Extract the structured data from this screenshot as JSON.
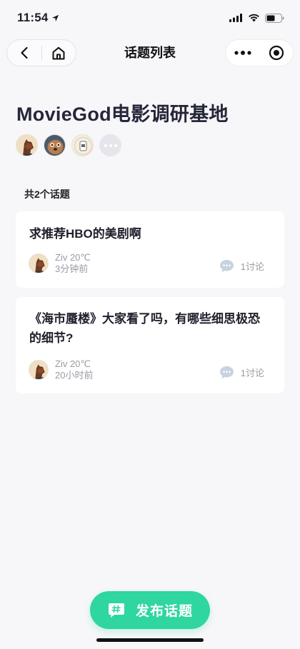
{
  "status_bar": {
    "time": "11:54"
  },
  "nav": {
    "title": "话题列表",
    "back_icon": "chevron-left-icon",
    "home_icon": "home-icon",
    "more_icon": "more-dots-icon",
    "close_icon": "target-circle-icon"
  },
  "group": {
    "title": "MovieGod电影调研基地"
  },
  "topics": {
    "count_label": "共2个话题",
    "items": [
      {
        "title": "求推荐HBO的美剧啊",
        "author": "Ziv 20℃",
        "time": "3分钟前",
        "discuss": "1讨论"
      },
      {
        "title": "《海市蜃楼》大家看了吗，有哪些细思极恐的细节?",
        "author": "Ziv 20℃",
        "time": "20小时前",
        "discuss": "1讨论"
      }
    ]
  },
  "publish": {
    "label": "发布话题"
  },
  "colors": {
    "accent": "#2fd69f",
    "background": "#f7f7fa",
    "muted_text": "#9a9aa5"
  }
}
